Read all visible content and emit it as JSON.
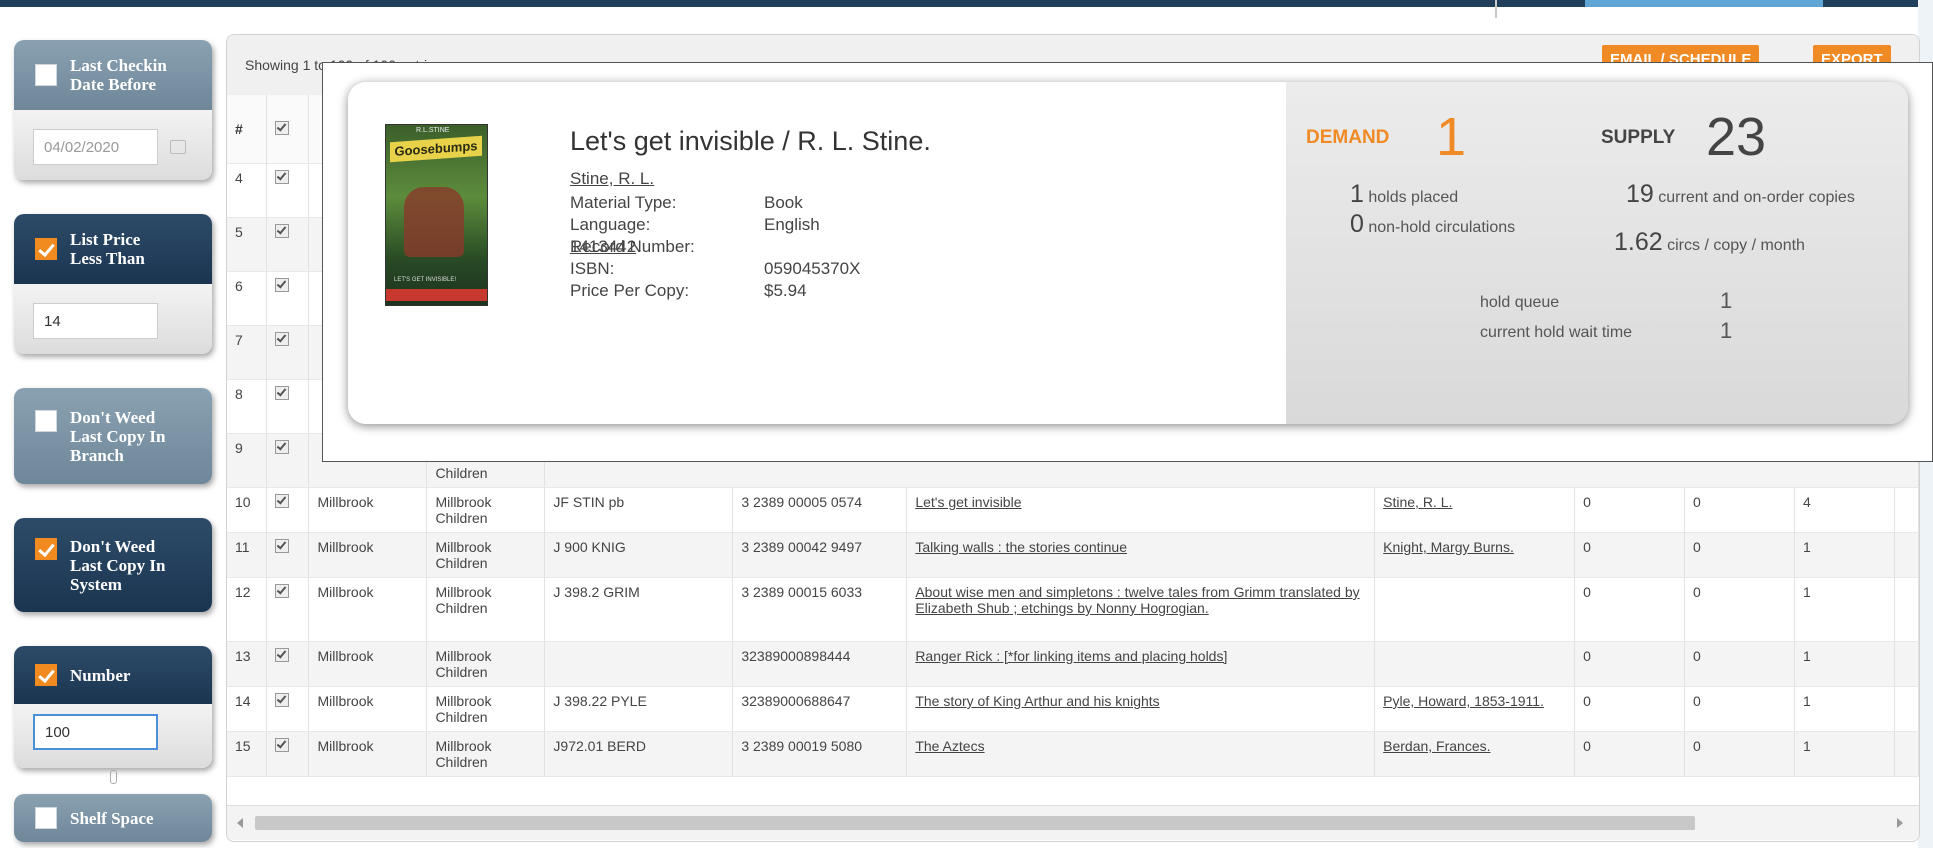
{
  "sidebar": {
    "last_checkin": {
      "label": "Last Checkin Date Before",
      "checked": false,
      "value": "04/02/2020"
    },
    "list_price": {
      "label": "List Price Less Than",
      "checked": true,
      "value": "14"
    },
    "dont_weed_branch": {
      "label": "Don't Weed Last Copy In Branch",
      "checked": false
    },
    "dont_weed_system": {
      "label": "Don't Weed Last Copy In System",
      "checked": true
    },
    "number": {
      "label": "Number",
      "checked": true,
      "value": "100"
    },
    "shelf_space": {
      "label": "Shelf Space",
      "checked": false
    }
  },
  "table": {
    "showing": "Showing 1 to 100 of 100 entries",
    "email_schedule": "EMAIL / SCHEDULE",
    "export": "EXPORT",
    "header_hash": "#",
    "row_numbers_hidden": [
      "4",
      "5",
      "6",
      "7",
      "8",
      "9"
    ],
    "partial_row9_collection": "Children",
    "rows": [
      {
        "n": "10",
        "branch": "Millbrook",
        "collection": "Millbrook Children",
        "call": "JF STIN pb",
        "barcode": "3 2389 00005 0574",
        "title": "Let's get invisible",
        "author": "Stine, R. L.",
        "c1": "0",
        "c2": "0",
        "c3": "4"
      },
      {
        "n": "11",
        "branch": "Millbrook",
        "collection": "Millbrook Children",
        "call": "J 900 KNIG",
        "barcode": "3 2389 00042 9497",
        "title": "Talking walls : the stories continue",
        "author": "Knight, Margy Burns.",
        "c1": "0",
        "c2": "0",
        "c3": "1"
      },
      {
        "n": "12",
        "branch": "Millbrook",
        "collection": "Millbrook Children",
        "call": "J 398.2 GRIM",
        "barcode": "3 2389 00015 6033",
        "title": "About wise men and simpletons : twelve tales from Grimm translated by Elizabeth Shub ; etchings by Nonny Hogrogian.",
        "author": "",
        "c1": "0",
        "c2": "0",
        "c3": "1"
      },
      {
        "n": "13",
        "branch": "Millbrook",
        "collection": "Millbrook Children",
        "call": "",
        "barcode": "32389000898444",
        "title": "Ranger Rick : [*for linking items and placing holds]",
        "author": "",
        "c1": "0",
        "c2": "0",
        "c3": "1"
      },
      {
        "n": "14",
        "branch": "Millbrook",
        "collection": "Millbrook Children",
        "call": "J 398.22 PYLE",
        "barcode": "32389000688647",
        "title": "The story of King Arthur and his knights",
        "author": "Pyle, Howard, 1853-1911.",
        "c1": "0",
        "c2": "0",
        "c3": "1"
      },
      {
        "n": "15",
        "branch": "Millbrook",
        "collection": "Millbrook Children",
        "call": "J972.01 BERD",
        "barcode": "3 2389 00019 5080",
        "title": "The Aztecs",
        "author": "Berdan, Frances.",
        "c1": "0",
        "c2": "0",
        "c3": "1"
      }
    ]
  },
  "popup": {
    "cover_author": "R.L.STINE",
    "cover_logo": "Goosebumps",
    "cover_title": "LET'S GET INVISIBLE!",
    "title": "Let's get invisible / R. L. Stine.",
    "author": "Stine, R. L.",
    "fields": [
      {
        "key": "Material Type:",
        "value": "Book"
      },
      {
        "key": "Language:",
        "value": "English"
      },
      {
        "key": "Record Number:",
        "value": "1413442"
      },
      {
        "key": "ISBN:",
        "value": "059045370X"
      },
      {
        "key": "Price Per Copy:",
        "value": "$5.94"
      }
    ],
    "demand_label": "DEMAND",
    "demand_value": "1",
    "supply_label": "SUPPLY",
    "supply_value": "23",
    "holds_placed_num": "1",
    "holds_placed": "holds placed",
    "non_hold_num": "0",
    "non_hold": "non-hold circulations",
    "current_copies_num": "19",
    "current_copies": "current and on-order copies",
    "circs_num": "1.62",
    "circs": "circs / copy / month",
    "hold_queue_label": "hold queue",
    "hold_queue_value": "1",
    "wait_label": "current hold wait time",
    "wait_value": "1"
  },
  "colors": {
    "accent": "#f08a24",
    "sidebar_dark": "#1f3b57",
    "sidebar_light": "#7d95a6"
  }
}
